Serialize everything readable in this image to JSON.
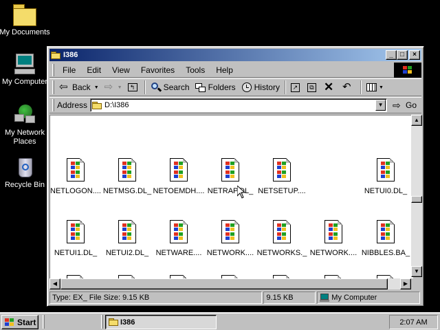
{
  "desktop": {
    "icons": [
      {
        "label": "My Documents"
      },
      {
        "label": "My Computer"
      },
      {
        "label": "My Network Places"
      },
      {
        "label": "Recycle Bin"
      }
    ]
  },
  "window": {
    "title": "I386",
    "controls": {
      "minimize": "_",
      "maximize": "□",
      "close": "×"
    }
  },
  "menu": [
    "File",
    "Edit",
    "View",
    "Favorites",
    "Tools",
    "Help"
  ],
  "toolbar": {
    "back": "Back",
    "search": "Search",
    "folders": "Folders",
    "history": "History"
  },
  "address": {
    "label": "Address",
    "value": "D:\\I386",
    "go": "Go"
  },
  "files": [
    {
      "name": "NETLOGON...."
    },
    {
      "name": "NETMSG.DL_"
    },
    {
      "name": "NETOEMDH...."
    },
    {
      "name": "NETRAP.DL_"
    },
    {
      "name": "NETSETUP...."
    },
    {
      "name": "NETUI0.DL_"
    },
    {
      "name": "NETUI1.DL_"
    },
    {
      "name": "NETUI2.DL_"
    },
    {
      "name": "NETWARE...."
    },
    {
      "name": "NETWORK...."
    },
    {
      "name": "NETWORKS._"
    },
    {
      "name": "NETWORK...."
    },
    {
      "name": "NIBBLES.BA_"
    }
  ],
  "status": {
    "info": "Type: EX_ File Size: 9.15 KB",
    "size": "9.15 KB",
    "zone": "My Computer"
  },
  "taskbar": {
    "start": "Start",
    "task": "I386",
    "clock": "2:07 AM"
  },
  "colors": {
    "title_active": "#0a246a",
    "title_gradient_end": "#a6caf0",
    "desktop": "#000000",
    "face": "#c0c0c0"
  }
}
